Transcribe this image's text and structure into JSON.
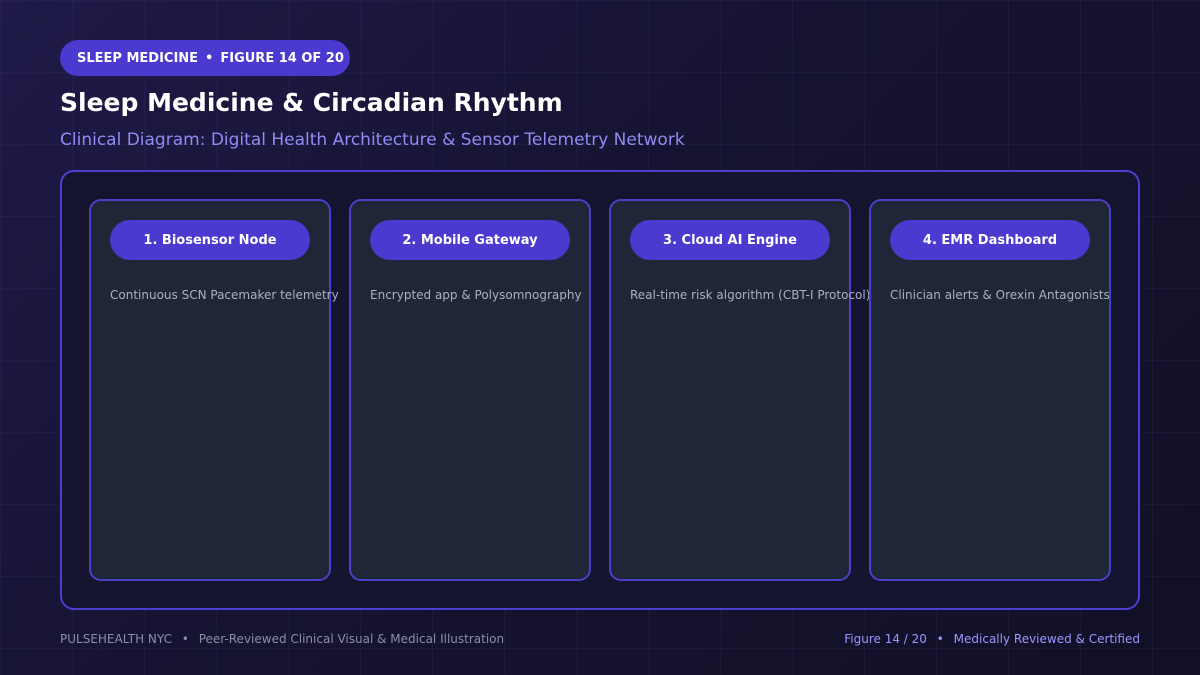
{
  "header": {
    "category": "SLEEP MEDICINE",
    "separator": "•",
    "figure_label": "FIGURE 14 OF 20",
    "title": "Sleep Medicine & Circadian Rhythm",
    "subtitle": "Clinical Diagram: Digital Health Architecture & Sensor Telemetry Network"
  },
  "diagram": {
    "cards": [
      {
        "label": "1. Biosensor Node",
        "description": "Continuous SCN Pacemaker telemetry"
      },
      {
        "label": "2. Mobile Gateway",
        "description": "Encrypted app & Polysomnography"
      },
      {
        "label": "3. Cloud AI Engine",
        "description": "Real-time risk algorithm (CBT-I Protocol)"
      },
      {
        "label": "4. EMR Dashboard",
        "description": "Clinician alerts & Orexin Antagonists"
      }
    ]
  },
  "footer": {
    "brand": "PULSEHEALTH NYC",
    "separator": "•",
    "tagline": "Peer-Reviewed Clinical Visual & Medical Illustration",
    "figure_count": "Figure 14 / 20",
    "certification": "Medically Reviewed & Certified"
  },
  "colors": {
    "accent": "#4a3ad0",
    "border": "#4a3fd0",
    "subtitle": "#8f8cf4",
    "card_bg": "#1e2637",
    "background": "#14122b"
  }
}
